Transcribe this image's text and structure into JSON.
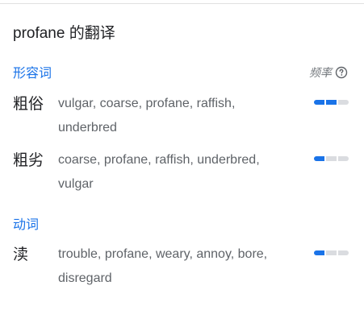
{
  "title": "profane 的翻译",
  "frequency_label": "频率",
  "sections": [
    {
      "pos": "形容词",
      "entries": [
        {
          "word": "粗俗",
          "translations": "vulgar, coarse, profane, raffish, underbred",
          "frequency": 2,
          "frequency_max": 3
        },
        {
          "word": "粗劣",
          "translations": "coarse, profane, raffish, underbred, vulgar",
          "frequency": 1,
          "frequency_max": 3
        }
      ]
    },
    {
      "pos": "动词",
      "entries": [
        {
          "word": "渎",
          "translations": "trouble, profane, weary, annoy, bore, disregard",
          "frequency": 1,
          "frequency_max": 3
        }
      ]
    }
  ],
  "colors": {
    "accent": "#1a73e8",
    "inactive_bar": "#dadce0"
  },
  "icons": {
    "help": "help-circle-icon"
  }
}
